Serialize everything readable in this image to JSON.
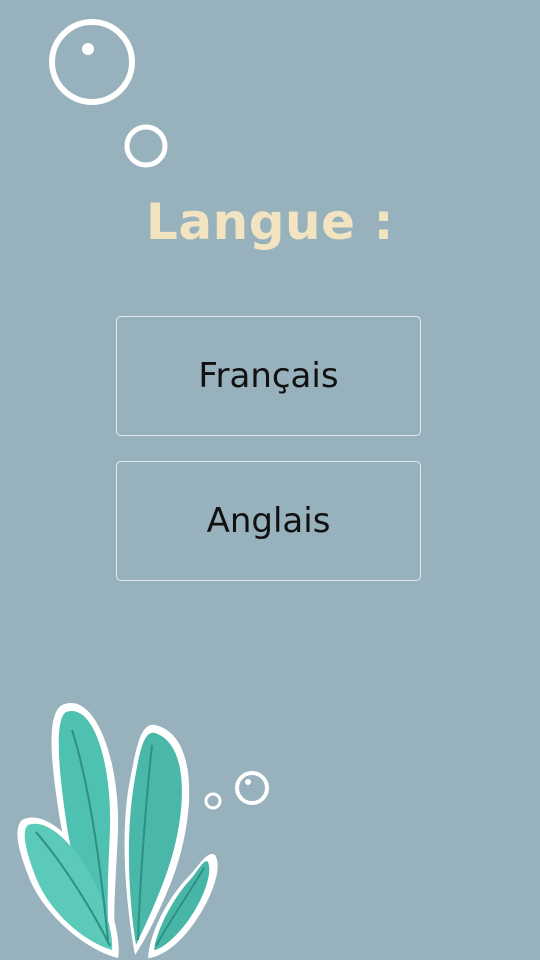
{
  "title": "Langue :",
  "languages": {
    "french": "Français",
    "english": "Anglais"
  },
  "colors": {
    "background": "#97b1bd",
    "title": "#f2e3c1",
    "button_border": "#e3ebee",
    "button_text": "#111111",
    "seaweed": "#4fc1b1"
  },
  "icons": [
    "bubble-icon",
    "seaweed-icon"
  ]
}
